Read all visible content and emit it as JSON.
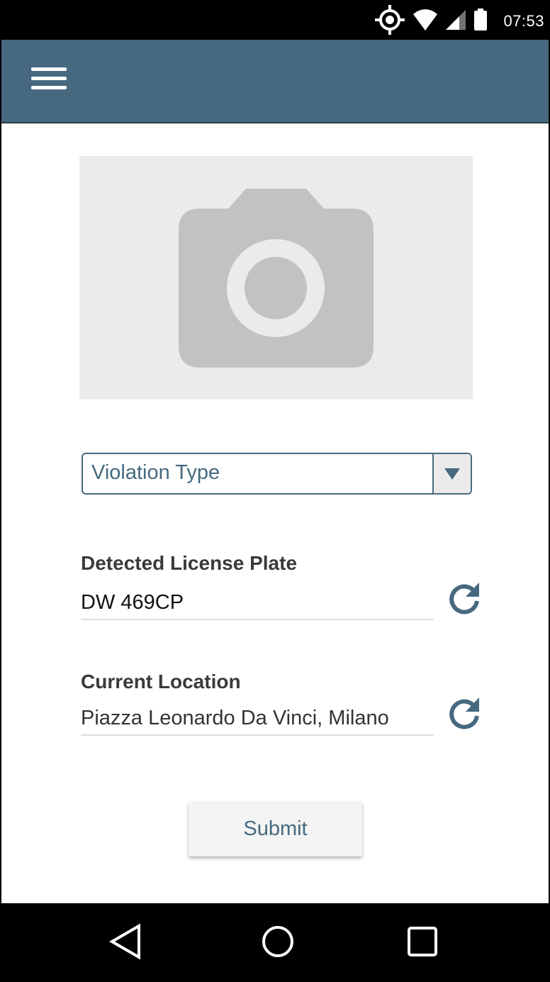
{
  "status_bar": {
    "time": "07:53",
    "icons": [
      "location-target-icon",
      "wifi-icon",
      "cell-signal-icon",
      "battery-icon"
    ]
  },
  "app_bar": {
    "menu_icon": "hamburger-menu-icon",
    "color": "#46697f"
  },
  "photo": {
    "icon": "camera-icon"
  },
  "violation_dropdown": {
    "selected": "Violation Type",
    "icon": "dropdown-arrow-icon"
  },
  "license_plate": {
    "label": "Detected License Plate",
    "value": "DW 469CP",
    "icon": "refresh-icon"
  },
  "location": {
    "label": "Current Location",
    "value": "Piazza Leonardo Da Vinci, Milano",
    "icon": "refresh-icon"
  },
  "submit": {
    "label": "Submit"
  },
  "nav_bar": {
    "icons": [
      "back-icon",
      "home-icon",
      "recents-icon"
    ]
  },
  "colors": {
    "accent": "#46697f",
    "placeholder_bg": "#ebebeb",
    "camera_gray": "#c2c2c2"
  }
}
